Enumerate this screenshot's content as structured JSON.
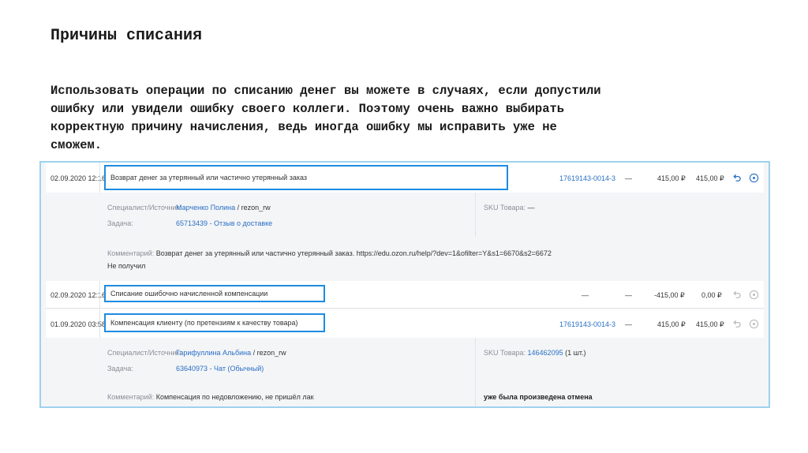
{
  "slide": {
    "title": "Причины списания",
    "text_lines": [
      "Использовать операции по списанию денег вы можете в случаях, если допустили",
      "ошибку или увидели ошибку своего коллеги. Поэтому очень важно выбирать",
      "корректную причину начисления, ведь иногда ошибку мы исправить уже не",
      "сможем."
    ]
  },
  "labels": {
    "specialist": "Специалист/Источник:",
    "task": "Задача:",
    "comment": "Комментарий:",
    "sku": "SKU Товара:"
  },
  "rows": [
    {
      "date": "02.09.2020 12:16",
      "reason": "Возврат денег за утерянный или частично утерянный заказ",
      "order": "17619143-0014-3",
      "dash": "—",
      "amount": "415,00 ₽",
      "total": "415,00 ₽",
      "specialist_name": "Марченко Полина",
      "specialist_source": " / rezon_rw",
      "task": "65713439 - Отзыв о доставке",
      "sku_value": " —",
      "comment_label": "Комментарий:",
      "comment_text": "Возврат денег за утерянный или частично утерянный заказ. https://edu.ozon.ru/help/?dev=1&ofilter=Y&s1=6670&s2=6672",
      "comment_line2": "Не получил"
    },
    {
      "date": "02.09.2020 12:16",
      "reason": "Списание ошибочно начисленной компенсации",
      "order": "—",
      "dash": "—",
      "amount": "-415,00 ₽",
      "total": "0,00 ₽"
    },
    {
      "date": "01.09.2020 03:58",
      "reason": "Компенсация клиенту (по претензиям к качеству товара)",
      "order": "17619143-0014-3",
      "dash": "—",
      "amount": "415,00 ₽",
      "total": "415,00 ₽",
      "specialist_name": "Гарифуллина Альбина",
      "specialist_source": " / rezon_rw",
      "task": "63640973 - Чат (Обычный)",
      "sku_link": "146462095",
      "sku_qty": " (1 шт.)",
      "comment_text": "Компенсация по недовложению, не пришёл лак",
      "status_text": "уже была произведена отмена"
    }
  ],
  "colors": {
    "highlight": "#1e8be0",
    "link": "#2a6fc4",
    "frame": "#9dd2ee",
    "icon_active": "#2a6fc4",
    "icon_disabled": "#bbbbbb"
  },
  "icons": [
    "undo-icon",
    "info-icon"
  ]
}
